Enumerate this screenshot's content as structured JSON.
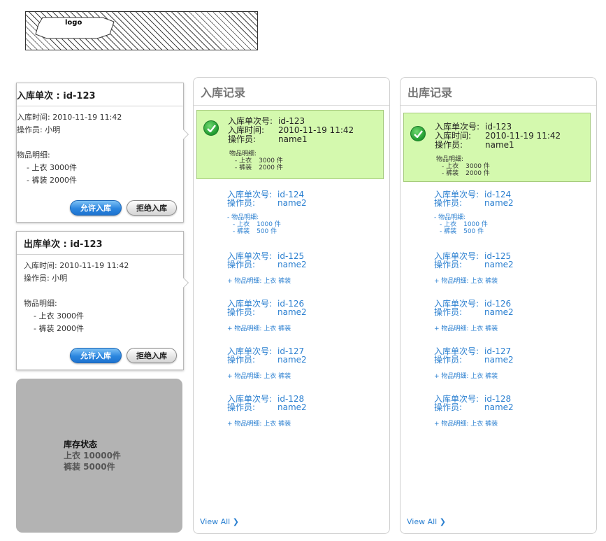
{
  "logo": {
    "text": "logo"
  },
  "inbound_card": {
    "title": "入库单次 : id-123",
    "time": "入库时间: 2010-11-19 11:42",
    "operator": "操作员: 小明",
    "items_label": "物品明细:",
    "item1": "- 上衣  3000件",
    "item2": "-  裤装 2000件",
    "approve_label": "允许入库",
    "reject_label": "拒绝入库"
  },
  "outbound_card": {
    "title": "出库单次 : id-123",
    "time": "入库时间: 2010-11-19 11:42",
    "operator": "操作员: 小明",
    "items_label": "物品明细:",
    "item1": "- 上衣  3000件",
    "item2": "-  裤装 2000件",
    "approve_label": "允许入库",
    "reject_label": "拒绝入库"
  },
  "stock": {
    "title": "库存状态",
    "line1": "上衣 10000件",
    "line2": "裤装 5000件"
  },
  "inbound_records": {
    "title": "入库记录",
    "highlighted": {
      "id_label": "入库单次号:",
      "id": "id-123",
      "time_label": "入库时间:",
      "time": "2010-11-19 11:42",
      "op_label": "操作员:",
      "op": "name1",
      "detail_label": "物品明细:",
      "item1": "- 上衣",
      "qty1": "3000 件",
      "item2": "- 裤装",
      "qty2": "2000 件"
    },
    "expanded": {
      "id_label": "入库单次号:",
      "id": "id-124",
      "op_label": "操作员:",
      "op": "name2",
      "detail_label": "- 物品明细:",
      "item1": "- 上衣",
      "qty1": "1000 件",
      "item2": "- 裤装",
      "qty2": "500 件"
    },
    "rows": [
      {
        "id_label": "入库单次号:",
        "id": "id-125",
        "op_label": "操作员:",
        "op": "name2",
        "detail": "+ 物品明细: 上衣 裤装"
      },
      {
        "id_label": "入库单次号:",
        "id": "id-126",
        "op_label": "操作员:",
        "op": "name2",
        "detail": "+ 物品明细: 上衣 裤装"
      },
      {
        "id_label": "入库单次号:",
        "id": "id-127",
        "op_label": "操作员:",
        "op": "name2",
        "detail": "+ 物品明细: 上衣 裤装"
      },
      {
        "id_label": "入库单次号:",
        "id": "id-128",
        "op_label": "操作员:",
        "op": "name2",
        "detail": "+ 物品明细: 上衣 裤装"
      }
    ],
    "view_all": "View All ❯"
  },
  "outbound_records": {
    "title": "出库记录",
    "highlighted": {
      "id_label": "入库单次号:",
      "id": "id-123",
      "time_label": "入库时间:",
      "time": "2010-11-19 11:42",
      "op_label": "操作员:",
      "op": "name1",
      "detail_label": "物品明细:",
      "item1": "- 上衣",
      "qty1": "3000 件",
      "item2": "- 裤装",
      "qty2": "2000 件"
    },
    "expanded": {
      "id_label": "入库单次号:",
      "id": "id-124",
      "op_label": "操作员:",
      "op": "name2",
      "detail_label": "- 物品明细:",
      "item1": "- 上衣",
      "qty1": "1000 件",
      "item2": "- 裤装",
      "qty2": "500 件"
    },
    "rows": [
      {
        "id_label": "入库单次号:",
        "id": "id-125",
        "op_label": "操作员:",
        "op": "name2",
        "detail": "+ 物品明细: 上衣 裤装"
      },
      {
        "id_label": "入库单次号:",
        "id": "id-126",
        "op_label": "操作员:",
        "op": "name2",
        "detail": "+ 物品明细: 上衣 裤装"
      },
      {
        "id_label": "入库单次号:",
        "id": "id-127",
        "op_label": "操作员:",
        "op": "name2",
        "detail": "+ 物品明细: 上衣 裤装"
      },
      {
        "id_label": "入库单次号:",
        "id": "id-128",
        "op_label": "操作员:",
        "op": "name2",
        "detail": "+ 物品明细: 上衣 裤装"
      }
    ],
    "view_all": "View All ❯"
  },
  "colors": {
    "highlight_bg": "#d4f9ae",
    "link_blue": "#2a7fd0",
    "primary_button": "#2b86df",
    "stock_panel": "#b3b3b3"
  },
  "icons": [
    "check-icon",
    "chevron-right-icon"
  ]
}
